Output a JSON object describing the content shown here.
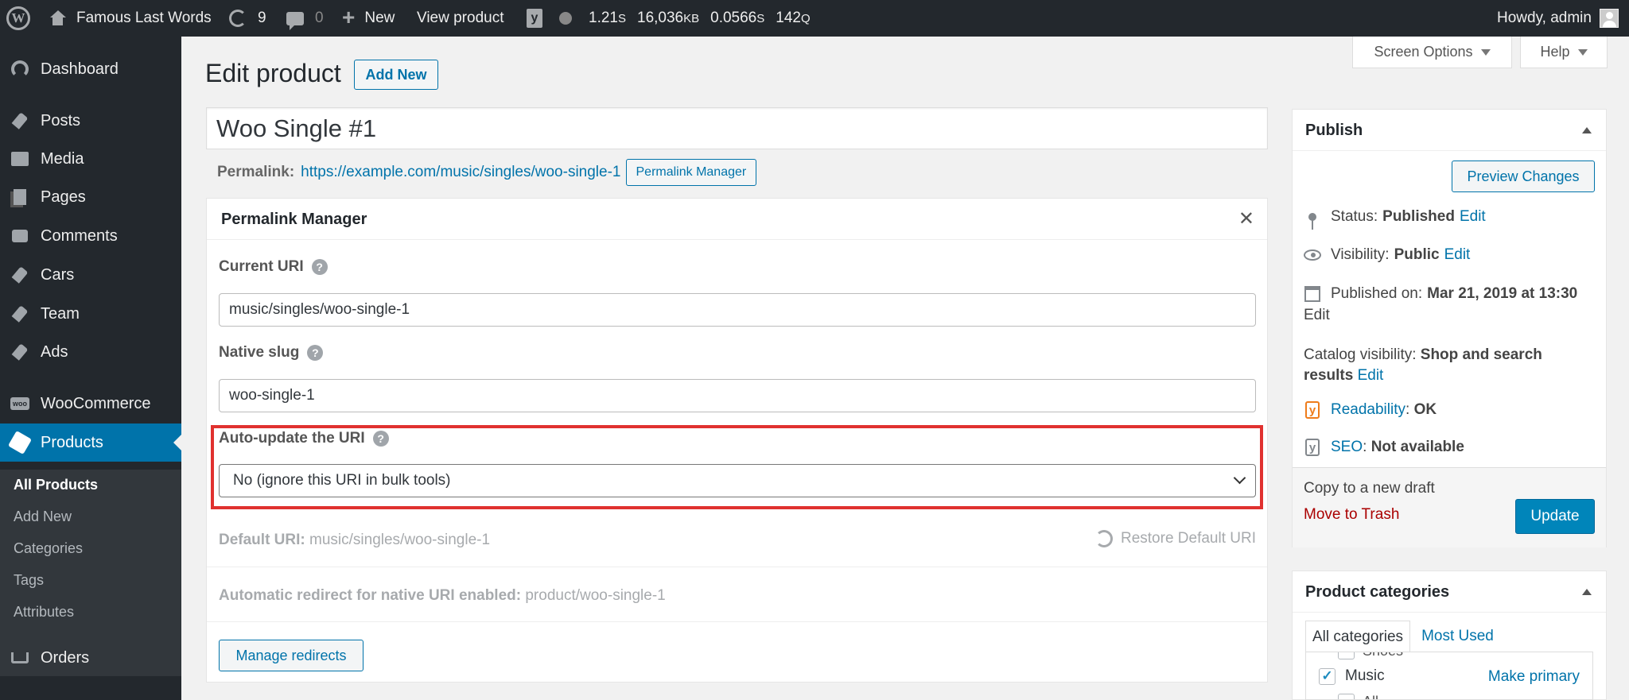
{
  "adminbar": {
    "site_name": "Famous Last Words",
    "updates_count": "9",
    "comments_count": "0",
    "new_label": "New",
    "view_product": "View product",
    "perf_time": "1.21",
    "perf_time_unit": "S",
    "perf_memory": "16,036",
    "perf_memory_unit": "KB",
    "perf_query_time": "0.0566",
    "perf_query_time_unit": "S",
    "perf_queries": "142",
    "perf_queries_unit": "Q",
    "howdy": "Howdy, admin"
  },
  "sidebar": {
    "items": [
      {
        "label": "Dashboard",
        "icon": "gauge-icon"
      },
      {
        "label": "Posts",
        "icon": "pin-icon"
      },
      {
        "label": "Media",
        "icon": "media-icon"
      },
      {
        "label": "Pages",
        "icon": "pages-icon"
      },
      {
        "label": "Comments",
        "icon": "comment-icon"
      },
      {
        "label": "Cars",
        "icon": "pin-icon"
      },
      {
        "label": "Team",
        "icon": "pin-icon"
      },
      {
        "label": "Ads",
        "icon": "pin-icon"
      },
      {
        "label": "WooCommerce",
        "icon": "woo-icon"
      },
      {
        "label": "Products",
        "icon": "box-icon"
      },
      {
        "label": "Orders",
        "icon": "cart-icon"
      }
    ],
    "products_submenu": [
      "All Products",
      "Add New",
      "Categories",
      "Tags",
      "Attributes"
    ]
  },
  "header": {
    "title": "Edit product",
    "add_new": "Add New",
    "screen_options": "Screen Options",
    "help": "Help"
  },
  "post": {
    "title": "Woo Single #1",
    "permalink_label": "Permalink:",
    "permalink_url": "https://example.com/music/singles/woo-single-1",
    "permalink_manager_button": "Permalink Manager"
  },
  "permalink_manager": {
    "title": "Permalink Manager",
    "current_uri_label": "Current URI",
    "current_uri_value": "music/singles/woo-single-1",
    "native_slug_label": "Native slug",
    "native_slug_value": "woo-single-1",
    "auto_update_label": "Auto-update the URI",
    "auto_update_selected": "No (ignore this URI in bulk tools)",
    "default_uri_label": "Default URI:",
    "default_uri_value": "music/singles/woo-single-1",
    "restore_default": "Restore Default URI",
    "redirect_label": "Automatic redirect for native URI enabled:",
    "redirect_value": "product/woo-single-1",
    "manage_redirects": "Manage redirects",
    "highlight_color": "#e0312f"
  },
  "publish": {
    "title": "Publish",
    "preview_changes": "Preview Changes",
    "status_label": "Status:",
    "status_value": "Published",
    "visibility_label": "Visibility:",
    "visibility_value": "Public",
    "published_on_label": "Published on:",
    "published_on_value": "Mar 21, 2019 at 13:30",
    "catalog_visibility_label": "Catalog visibility:",
    "catalog_visibility_value": "Shop and search results",
    "edit": "Edit",
    "readability_link": "Readability",
    "readability_value": "OK",
    "seo_link": "SEO",
    "seo_value": "Not available",
    "copy_draft": "Copy to a new draft",
    "move_trash": "Move to Trash",
    "update": "Update"
  },
  "categories": {
    "title": "Product categories",
    "tab_all": "All categories",
    "tab_most_used": "Most Used",
    "item_above": "Shoes",
    "item_music": "Music",
    "music_checked": true,
    "make_primary": "Make primary",
    "item_below": "All"
  },
  "colors": {
    "accent": "#0073aa",
    "sidebar_bg": "#23282d",
    "primary_button": "#0085ba"
  }
}
